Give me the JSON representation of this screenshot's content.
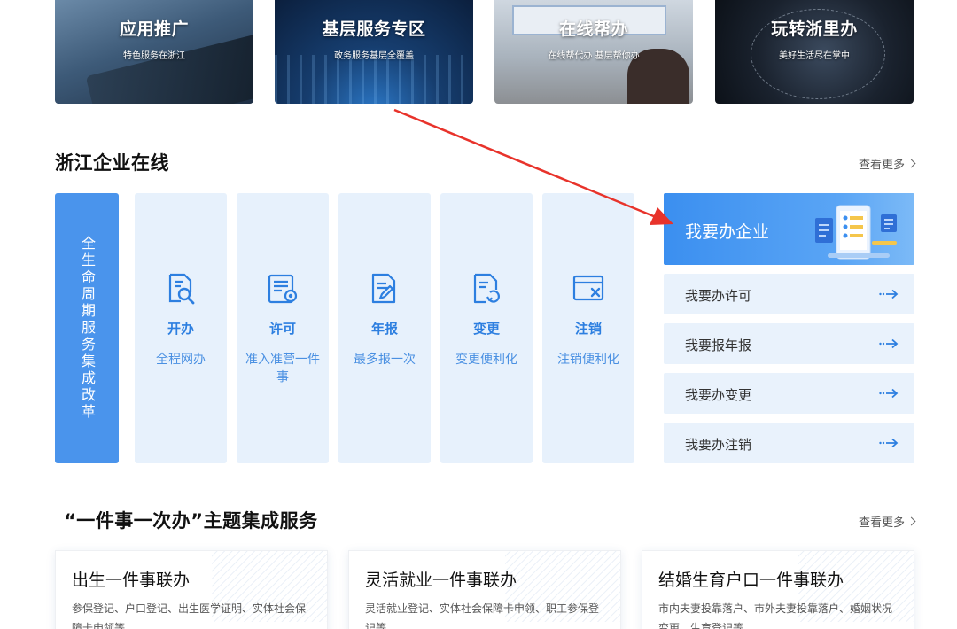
{
  "banners": [
    {
      "title": "应用推广",
      "subtitle": "特色服务在浙江"
    },
    {
      "title": "基层服务专区",
      "subtitle": "政务服务基层全覆盖"
    },
    {
      "title": "在线帮办",
      "subtitle": "在线帮代办 基层帮你办"
    },
    {
      "title": "玩转浙里办",
      "subtitle": "美好生活尽在掌中"
    }
  ],
  "enterprise": {
    "title": "浙江企业在线",
    "more": "查看更多",
    "lifecycle_label": "全生命周期服务集成改革",
    "stages": [
      {
        "label": "开办",
        "desc": "全程网办",
        "icon": "document-search-icon"
      },
      {
        "label": "许可",
        "desc": "准入准营一件事",
        "icon": "certificate-icon"
      },
      {
        "label": "年报",
        "desc": "最多报一次",
        "icon": "document-edit-icon"
      },
      {
        "label": "变更",
        "desc": "变更便利化",
        "icon": "document-refresh-icon"
      },
      {
        "label": "注销",
        "desc": "注销便利化",
        "icon": "window-close-icon"
      }
    ],
    "main_action": "我要办企业",
    "actions": [
      "我要办许可",
      "我要报年报",
      "我要办变更",
      "我要办注销"
    ]
  },
  "theme": {
    "title": "“一件事一次办”主题集成服务",
    "more": "查看更多",
    "cards": [
      {
        "title": "出生一件事联办",
        "desc": "参保登记、户口登记、出生医学证明、实体社会保障卡申领等"
      },
      {
        "title": "灵活就业一件事联办",
        "desc": "灵活就业登记、实体社会保障卡申领、职工参保登记等"
      },
      {
        "title": "结婚生育户口一件事联办",
        "desc": "市内夫妻投靠落户、市外夫妻投靠落户、婚姻状况变更、生育登记等"
      }
    ]
  },
  "colors": {
    "primary": "#4a94ec",
    "tile_bg": "#e7f1fc",
    "annotation": "#e8332b"
  }
}
